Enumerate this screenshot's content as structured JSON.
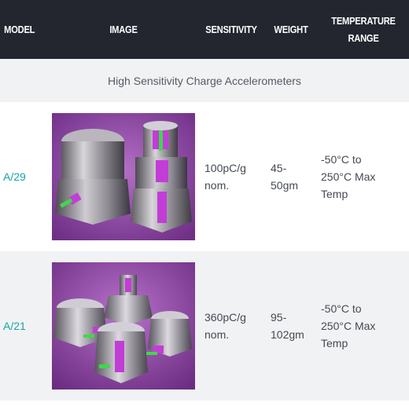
{
  "header": {
    "model": "MODEL",
    "image": "IMAGE",
    "sensitivity": "SENSITIVITY",
    "weight": "WEIGHT",
    "temperature_line1": "TEMPERATURE",
    "temperature_line2": "RANGE",
    "background": "#23262f"
  },
  "section": {
    "title": "High Sensitivity Charge Accelerometers"
  },
  "rows": [
    {
      "model": "A/29",
      "sensitivity_line1": "100pC/g",
      "sensitivity_line2": "nom.",
      "weight_line1": "45-",
      "weight_line2": "50gm",
      "temp_line1": "-50°C to",
      "temp_line2": "250°C Max",
      "temp_line3": "Temp",
      "image_icon": "accelerometer-photo-a29"
    },
    {
      "model": "A/21",
      "sensitivity_line1": "360pC/g",
      "sensitivity_line2": "nom.",
      "weight_line1": "95-",
      "weight_line2": "102gm",
      "temp_line1": "-50°C to",
      "temp_line2": "250°C Max",
      "temp_line3": "Temp",
      "image_icon": "accelerometer-photo-a21"
    }
  ],
  "colors": {
    "model_link": "#1aa3a3",
    "row_alt_bg": "#f1f2f4",
    "photo_bg": "#8e3fa4"
  }
}
